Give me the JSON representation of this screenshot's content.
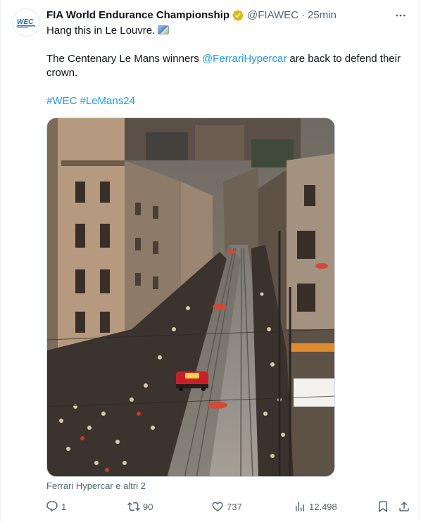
{
  "tweet": {
    "author_name": "FIA World Endurance Championship",
    "handle": "@FIAWEC",
    "separator": "·",
    "time": "25min",
    "line1": "Hang this in Le Louvre.",
    "line2_prefix": "The Centenary Le Mans winners ",
    "mention": "@FerrariHypercar",
    "line2_suffix": " are back to defend their crown.",
    "hashtag1": "#WEC",
    "hashtag2": "#LeMans24",
    "tagged": "Ferrari Hypercar e altri 2"
  },
  "actions": {
    "replies": "1",
    "reposts": "90",
    "likes": "737",
    "views": "12.498"
  },
  "colors": {
    "link": "#1d9bf0",
    "muted": "#536471",
    "verified": "#e2b719",
    "text": "#0f1419"
  },
  "icons": [
    "wec-logo",
    "verified-badge-icon",
    "more-icon",
    "framed-picture-icon",
    "reply-icon",
    "repost-icon",
    "like-icon",
    "views-icon",
    "bookmark-icon",
    "share-icon"
  ]
}
